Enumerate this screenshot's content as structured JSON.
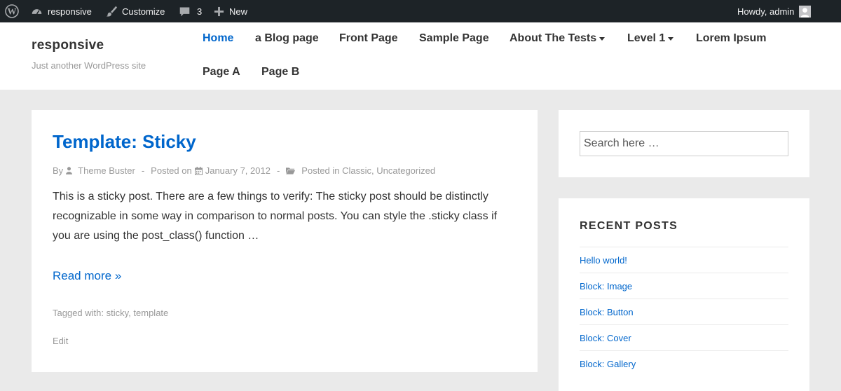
{
  "admin_bar": {
    "wp_logo_icon": "wordpress-logo-icon",
    "site_name": "responsive",
    "customize": "Customize",
    "comments_count": "3",
    "new": "New",
    "howdy": "Howdy, admin"
  },
  "header": {
    "site_title": "responsive",
    "tagline": "Just another WordPress site",
    "nav": [
      {
        "label": "Home",
        "active": true
      },
      {
        "label": "a Blog page"
      },
      {
        "label": "Front Page"
      },
      {
        "label": "Sample Page"
      },
      {
        "label": "About The Tests",
        "has_dropdown": true
      },
      {
        "label": "Level 1",
        "has_dropdown": true
      },
      {
        "label": "Lorem Ipsum"
      },
      {
        "label": "Page A"
      },
      {
        "label": "Page B"
      }
    ]
  },
  "post": {
    "title": "Template: Sticky",
    "by": "By",
    "author": "Theme Buster",
    "sep": "-",
    "posted_on": "Posted on",
    "date": "January 7, 2012",
    "posted_in": "Posted in",
    "categories": [
      "Classic",
      "Uncategorized"
    ],
    "excerpt": "This is a sticky post. There are a few things to verify: The sticky post should be distinctly recognizable in some way in comparison to normal posts. You can style the .sticky class if you are using the post_class() function …",
    "read_more": "Read more »",
    "tagged_with": "Tagged with:",
    "tags": [
      "sticky",
      "template"
    ],
    "edit": "Edit"
  },
  "sidebar": {
    "search_placeholder": "Search here …",
    "recent_posts_title": "RECENT POSTS",
    "recent_posts": [
      "Hello world!",
      "Block: Image",
      "Block: Button",
      "Block: Cover",
      "Block: Gallery"
    ]
  },
  "colors": {
    "admin_bar_bg": "#1d2327",
    "link": "#0066cc",
    "page_bg": "#eaeaea"
  }
}
